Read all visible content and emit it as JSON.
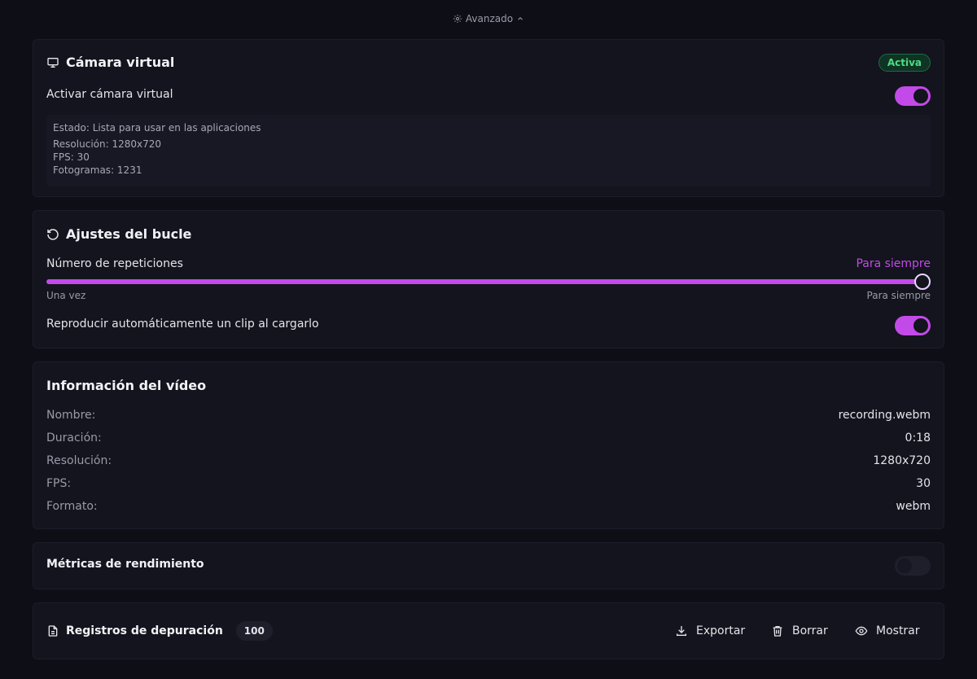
{
  "header": {
    "advanced_label": "Avanzado"
  },
  "virtual_camera": {
    "title": "Cámara virtual",
    "badge": "Activa",
    "toggle_label": "Activar cámara virtual",
    "toggle_on": true,
    "status_lines": [
      "Estado: Lista para usar en las aplicaciones",
      "Resolución: 1280x720",
      "FPS: 30",
      "Fotogramas: 1231"
    ]
  },
  "loop_settings": {
    "title": "Ajustes del bucle",
    "repetitions_label": "Número de repeticiones",
    "repetitions_value": "Para siempre",
    "slider_min_label": "Una vez",
    "slider_max_label": "Para siempre",
    "slider_position": 1.0,
    "autoplay_label": "Reproducir automáticamente un clip al cargarlo",
    "autoplay_on": true
  },
  "video_info": {
    "title": "Información del vídeo",
    "rows": [
      {
        "key": "Nombre:",
        "value": "recording.webm"
      },
      {
        "key": "Duración:",
        "value": "0:18"
      },
      {
        "key": "Resolución:",
        "value": "1280x720"
      },
      {
        "key": "FPS:",
        "value": "30"
      },
      {
        "key": "Formato:",
        "value": "webm"
      }
    ]
  },
  "performance": {
    "title": "Métricas de rendimiento",
    "toggle_on": false
  },
  "debug_logs": {
    "title": "Registros de depuración",
    "count": "100",
    "export_label": "Exportar",
    "clear_label": "Borrar",
    "show_label": "Mostrar"
  },
  "colors": {
    "accent": "#c24ae8",
    "badge_green": "#4ade80",
    "background": "#0e0f16",
    "card": "#13141d"
  }
}
